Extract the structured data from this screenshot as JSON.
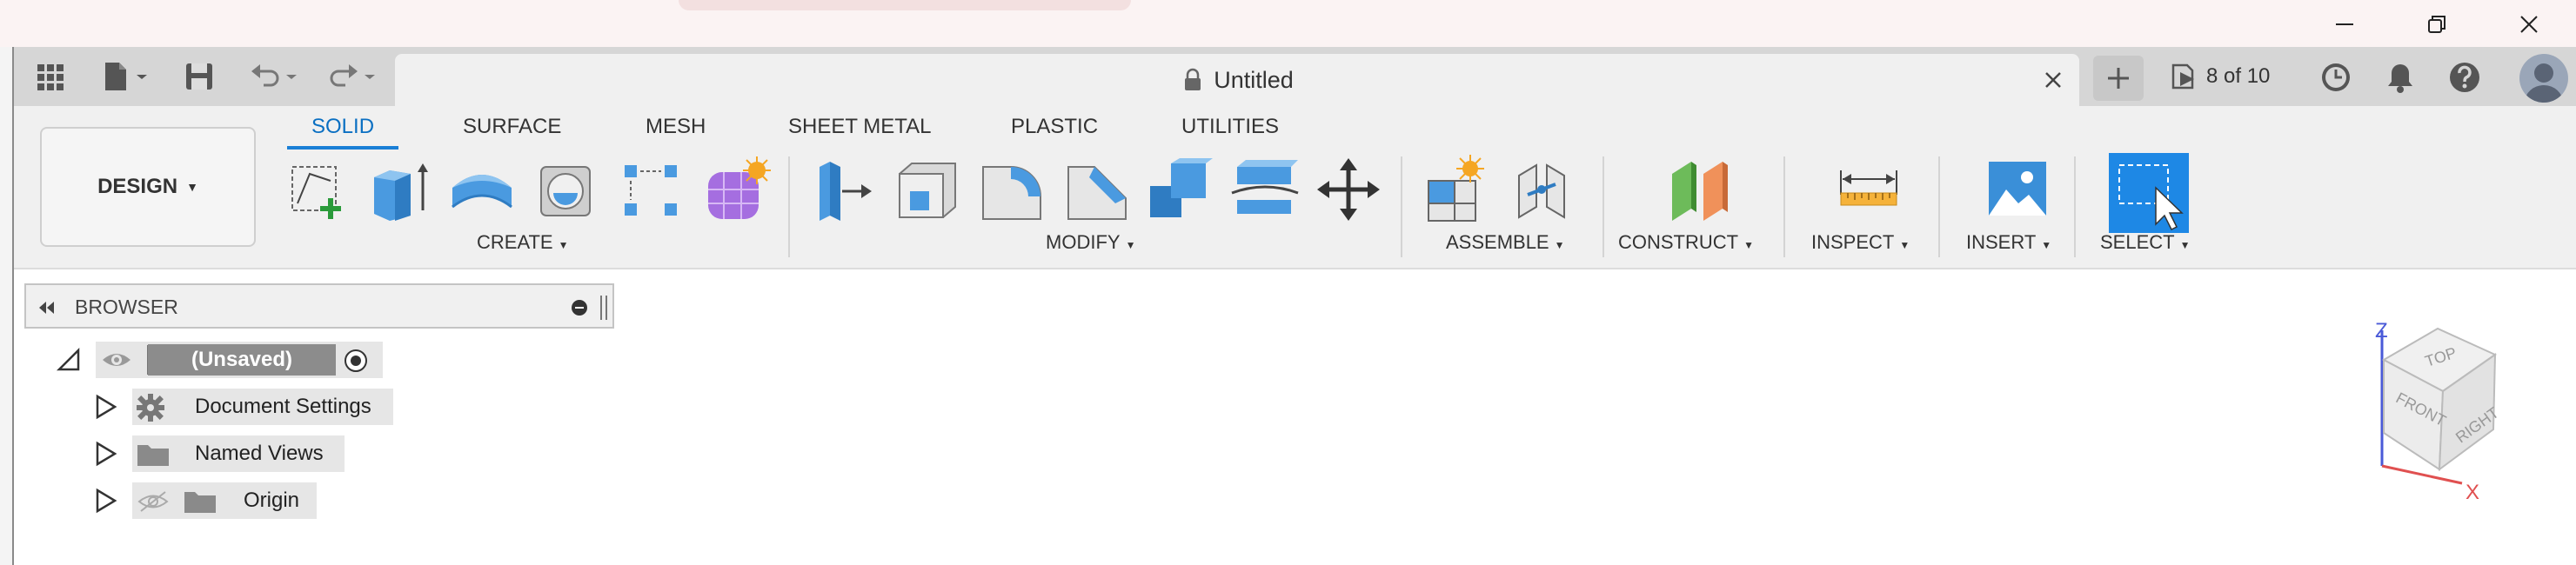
{
  "os": {
    "minimize_icon": "minimize-icon",
    "restore_icon": "restore-icon",
    "close_icon": "close-icon"
  },
  "tabbar": {
    "document_title": "Untitled",
    "jobs_label": "8 of 10"
  },
  "ribbon": {
    "workspace": "DESIGN",
    "tabs": [
      "SOLID",
      "SURFACE",
      "MESH",
      "SHEET METAL",
      "PLASTIC",
      "UTILITIES"
    ],
    "groups": [
      "CREATE",
      "MODIFY",
      "ASSEMBLE",
      "CONSTRUCT",
      "INSPECT",
      "INSERT",
      "SELECT"
    ]
  },
  "browser": {
    "title": "BROWSER",
    "root_label": "(Unsaved)",
    "nodes": [
      "Document Settings",
      "Named Views",
      "Origin"
    ]
  },
  "viewcube": {
    "top": "TOP",
    "front": "FRONT",
    "right": "RIGHT",
    "axis_z": "Z",
    "axis_x": "X"
  },
  "colors": {
    "accent": "#1a7fd6",
    "tab_bar": "#d6d6d6",
    "ribbon": "#f0f0f0"
  }
}
